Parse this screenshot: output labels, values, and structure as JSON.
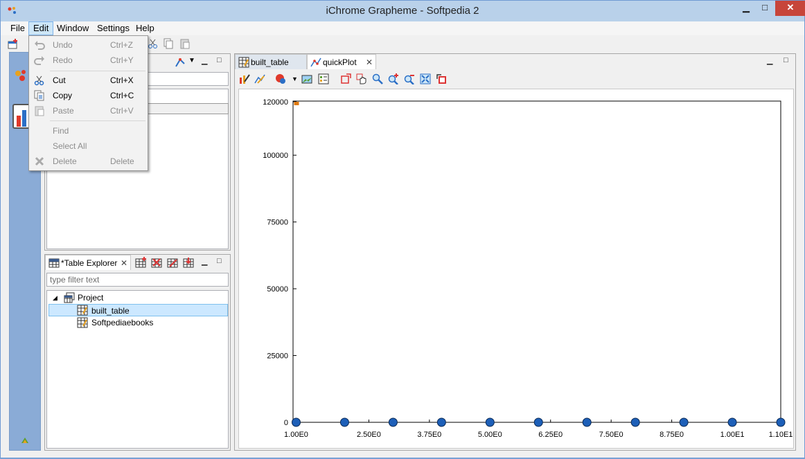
{
  "window": {
    "title": "iChrome Grapheme - Softpedia 2",
    "min_symbol": "▁",
    "max_symbol": "□",
    "close_symbol": "✕"
  },
  "menubar": {
    "items": [
      "File",
      "Edit",
      "Window",
      "Settings",
      "Help"
    ]
  },
  "edit_menu": {
    "items": [
      {
        "label": "Undo",
        "accel": "Ctrl+Z",
        "icon": "undo-icon",
        "enabled": false
      },
      {
        "label": "Redo",
        "accel": "Ctrl+Y",
        "icon": "redo-icon",
        "enabled": false
      },
      {
        "label": "Cut",
        "accel": "Ctrl+X",
        "icon": "cut-icon",
        "enabled": true
      },
      {
        "label": "Copy",
        "accel": "Ctrl+C",
        "icon": "copy-icon",
        "enabled": true
      },
      {
        "label": "Paste",
        "accel": "Ctrl+V",
        "icon": "paste-icon",
        "enabled": false
      },
      {
        "label": "Find",
        "accel": "",
        "icon": "",
        "enabled": false
      },
      {
        "label": "Select All",
        "accel": "",
        "icon": "",
        "enabled": false
      },
      {
        "label": "Delete",
        "accel": "Delete",
        "icon": "delete-icon",
        "enabled": false
      }
    ]
  },
  "table_explorer": {
    "tab_label": "*Table Explorer",
    "filter_placeholder": "type filter text",
    "tree": {
      "root": "Project",
      "children": [
        "built_table",
        "Softpediaebooks"
      ],
      "selected": "built_table"
    }
  },
  "editor": {
    "tabs": [
      {
        "label": "built_table",
        "active": false
      },
      {
        "label": "quickPlot",
        "active": true
      }
    ]
  },
  "chart_data": {
    "type": "scatter",
    "title": "",
    "xlabel": "",
    "ylabel": "",
    "xlim": [
      0.95,
      11.0
    ],
    "ylim": [
      0,
      120000
    ],
    "x_ticks": [
      "1.00E0",
      "2.50E0",
      "3.75E0",
      "5.00E0",
      "6.25E0",
      "7.50E0",
      "8.75E0",
      "1.00E1",
      "1.10E1"
    ],
    "y_ticks": [
      "120000",
      "100000",
      "75000",
      "50000",
      "25000",
      "0"
    ],
    "series": [
      {
        "x": [
          1,
          2,
          3,
          4,
          5,
          6,
          7,
          8,
          9,
          10,
          11
        ],
        "y": [
          0,
          0,
          0,
          0,
          0,
          0,
          0,
          0,
          0,
          0,
          0
        ],
        "color": "#1d5fb8"
      }
    ],
    "marker_at_top_left": {
      "x": 1,
      "y": 120000,
      "color": "#e07a10"
    }
  }
}
